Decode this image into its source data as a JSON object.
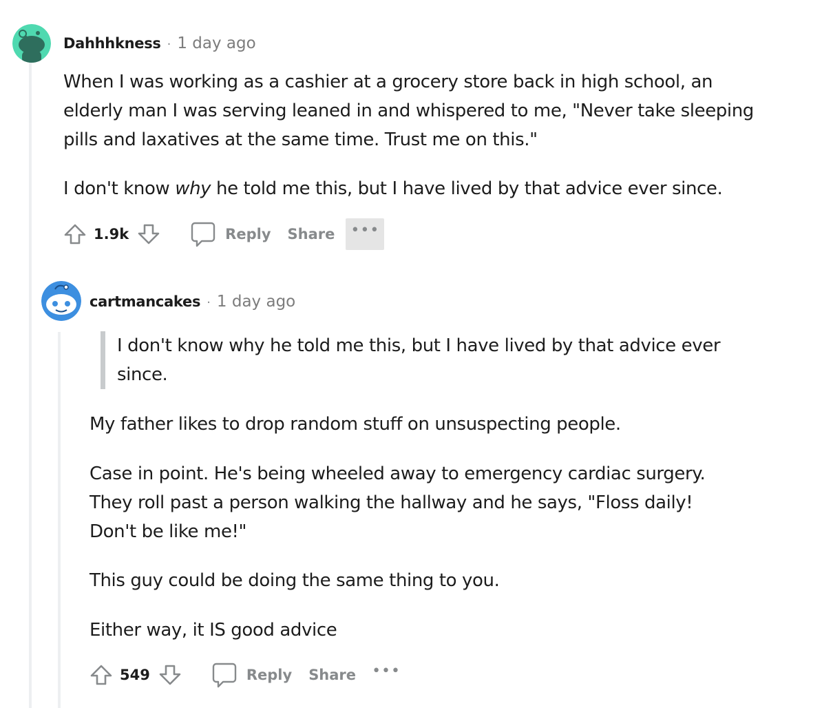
{
  "comments": [
    {
      "username": "Dahhhkness",
      "separator": "·",
      "timestamp": "1 day ago",
      "avatar_color": "#4fd9b0",
      "paragraphs": [
        "When I was working as a cashier at a grocery store back in high school, an elderly man I was serving leaned in and whispered to me, \"Never take sleeping pills and laxatives at the same time. Trust me on this.\""
      ],
      "p2_before": "I don't know ",
      "p2_em": "why",
      "p2_after": " he told me this, but I have lived by that advice ever since.",
      "actions": {
        "upvote_icon": "upvote-arrow-icon",
        "score": "1.9k",
        "downvote_icon": "downvote-arrow-icon",
        "reply_icon": "speech-bubble-icon",
        "reply_label": "Reply",
        "share_label": "Share",
        "more_label": "•••"
      }
    },
    {
      "username": "cartmancakes",
      "separator": "·",
      "timestamp": "1 day ago",
      "avatar_color": "#3d8fe0",
      "quote": "I don't know why he told me this, but I have lived by that advice ever since.",
      "paragraphs": [
        "My father likes to drop random stuff on unsuspecting people.",
        "Case in point. He's being wheeled away to emergency cardiac surgery. They roll past a person walking the hallway and he says, \"Floss daily! Don't be like me!\"",
        "This guy could be doing the same thing to you.",
        "Either way, it IS good advice"
      ],
      "actions": {
        "upvote_icon": "upvote-arrow-icon",
        "score": "549",
        "downvote_icon": "downvote-arrow-icon",
        "reply_icon": "speech-bubble-icon",
        "reply_label": "Reply",
        "share_label": "Share",
        "more_label": "•••"
      }
    }
  ],
  "colors": {
    "text": "#1c1c1c",
    "muted": "#878a8c",
    "thread_line": "#edeff1",
    "quote_bar": "#c8cbcd",
    "more_active_bg": "#e5e5e5"
  }
}
